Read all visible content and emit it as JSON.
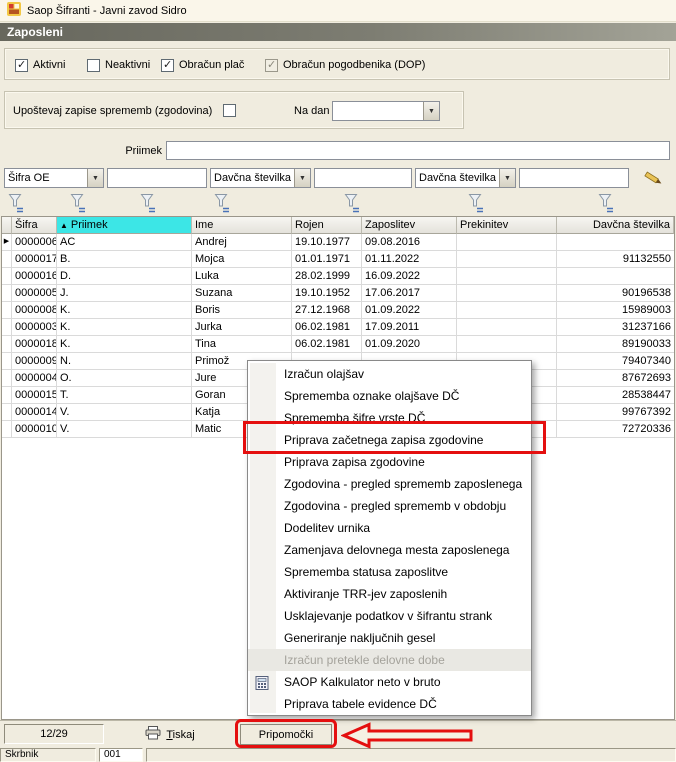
{
  "window": {
    "title": "Saop Šifranti - Javni zavod Sidro"
  },
  "section_header": {
    "title": "Zaposleni"
  },
  "filters": {
    "checkboxes": [
      {
        "label": "Aktivni",
        "checked": true,
        "disabled": false
      },
      {
        "label": "Neaktivni",
        "checked": false,
        "disabled": false
      },
      {
        "label": "Obračun plač",
        "checked": true,
        "disabled": false
      },
      {
        "label": "Obračun pogodbenika (DOP)",
        "checked": true,
        "disabled": true
      }
    ],
    "history": {
      "label": "Upoštevaj zapise sprememb (zgodovina)",
      "checked": false
    },
    "na_dan": {
      "label": "Na dan",
      "value": ""
    },
    "priimek": {
      "label": "Priimek",
      "value": ""
    },
    "column_filters": [
      {
        "type": "select",
        "value": "Šifra OE"
      },
      {
        "type": "input",
        "value": ""
      },
      {
        "type": "select",
        "value": "Davčna številka"
      },
      {
        "type": "input",
        "value": ""
      },
      {
        "type": "select",
        "value": "Davčna številka"
      },
      {
        "type": "input",
        "value": ""
      }
    ]
  },
  "icons": {
    "dropdown": "▼",
    "checkmark": "✓",
    "sort_ascending": "▲",
    "row_selector": "▶"
  },
  "table": {
    "columns": [
      "Šifra",
      "Priimek",
      "Ime",
      "Rojen",
      "Zaposlitev",
      "Prekinitev",
      "Davčna številka"
    ],
    "sort_column": "Priimek",
    "sort_indicator": "▲",
    "selected_row_index": 0,
    "selected_marker": "▶",
    "rows": [
      [
        "0000006",
        "AC",
        "Andrej",
        "19.10.1977",
        "09.08.2016",
        "",
        ""
      ],
      [
        "0000017",
        "B.",
        "Mojca",
        "01.01.1971",
        "01.11.2022",
        "",
        "91132550"
      ],
      [
        "0000016",
        "D.",
        "Luka",
        "28.02.1999",
        "16.09.2022",
        "",
        ""
      ],
      [
        "0000005",
        "J.",
        "Suzana",
        "19.10.1952",
        "17.06.2017",
        "",
        "90196538"
      ],
      [
        "0000008",
        "K.",
        "Boris",
        "27.12.1968",
        "01.09.2022",
        "",
        "15989003"
      ],
      [
        "0000003",
        "K.",
        "Jurka",
        "06.02.1981",
        "17.09.2011",
        "",
        "31237166"
      ],
      [
        "0000018",
        "K.",
        "Tina",
        "06.02.1981",
        "01.09.2020",
        "",
        "89190033"
      ],
      [
        "0000009",
        "N.",
        "Primož",
        "",
        "",
        "",
        "79407340"
      ],
      [
        "0000004",
        "O.",
        "Jure",
        "",
        "",
        "",
        "87672693"
      ],
      [
        "0000015",
        "T.",
        "Goran",
        "",
        "",
        "",
        "28538447"
      ],
      [
        "0000014",
        "V.",
        "Katja",
        "",
        "",
        "",
        "99767392"
      ],
      [
        "0000010",
        "V.",
        "Matic",
        "",
        "",
        "",
        "72720336"
      ]
    ]
  },
  "context_menu": {
    "items": [
      {
        "label": "Izračun olajšav"
      },
      {
        "label": "Sprememba oznake olajšave DČ"
      },
      {
        "label": "Sprememba šifre vrste DČ"
      },
      {
        "label": "Priprava začetnega zapisa zgodovine",
        "annotated": true
      },
      {
        "label": "Priprava zapisa zgodovine"
      },
      {
        "label": "Zgodovina - pregled sprememb zaposlenega"
      },
      {
        "label": "Zgodovina - pregled sprememb v obdobju"
      },
      {
        "label": "Dodelitev urnika"
      },
      {
        "label": "Zamenjava delovnega mesta zaposlenega"
      },
      {
        "label": "Sprememba statusa zaposlitve"
      },
      {
        "label": "Aktiviranje TRR-jev zaposlenih"
      },
      {
        "label": "Usklajevanje podatkov v šifrantu strank"
      },
      {
        "label": "Generiranje naključnih gesel"
      },
      {
        "label": "Izračun pretekle delovne dobe",
        "disabled": true
      },
      {
        "label": "SAOP Kalkulator neto v bruto",
        "icon": "calculator-icon"
      },
      {
        "label": "Priprava tabele evidence DČ"
      }
    ]
  },
  "footer": {
    "counter": "12/29",
    "tiskaj_label": "Tiskaj",
    "pripomocki_label": "Pripomočki"
  },
  "statusbar": {
    "user": "Skrbnik",
    "code": "001"
  },
  "colors": {
    "annotation_red": "#E40F0F",
    "sort_header_cyan": "#3CE6E6",
    "header_bar_dark": "#67675D"
  }
}
